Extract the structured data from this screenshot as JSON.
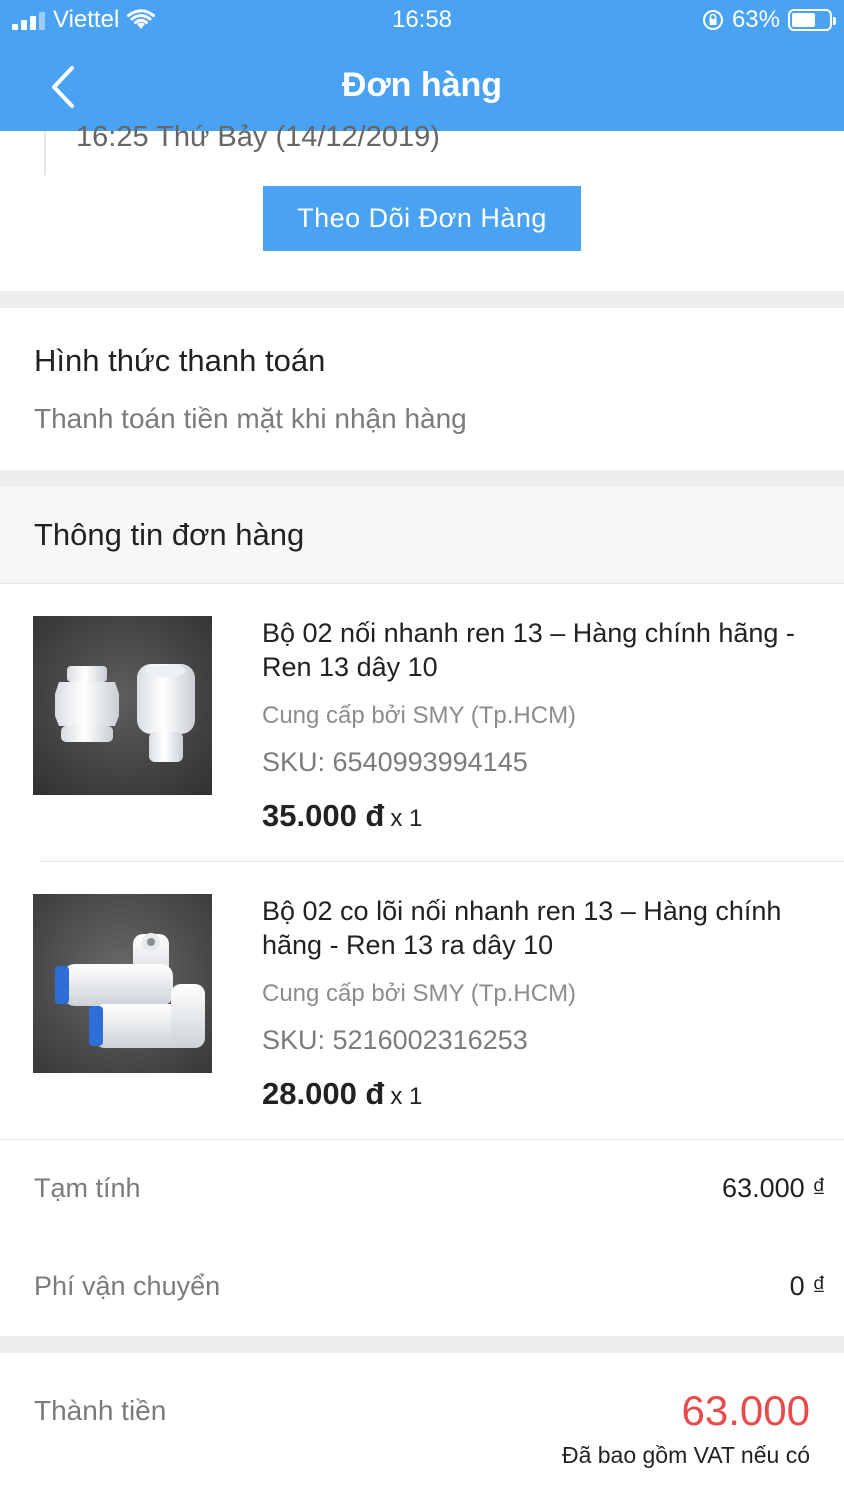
{
  "status_bar": {
    "carrier": "Viettel",
    "time": "16:58",
    "battery": "63%",
    "battery_level": 0.63
  },
  "header": {
    "title": "Đơn hàng"
  },
  "tracking": {
    "time_text": "16:25 Thứ Bảy (14/12/2019)",
    "button_label": "Theo Dõi Đơn Hàng"
  },
  "payment": {
    "heading": "Hình thức thanh toán",
    "method": "Thanh toán tiền mặt khi nhận hàng"
  },
  "order": {
    "heading": "Thông tin đơn hàng",
    "items": [
      {
        "name": "Bộ 02 nối nhanh ren 13 – Hàng chính hãng - Ren 13 dây 10",
        "seller": "Cung cấp bởi SMY (Tp.HCM)",
        "sku": "SKU: 6540993994145",
        "price": "35.000 đ",
        "qty": "x 1"
      },
      {
        "name": "Bộ 02 co lõi nối nhanh ren 13 – Hàng chính hãng - Ren 13 ra dây 10",
        "seller": "Cung cấp bởi SMY (Tp.HCM)",
        "sku": "SKU: 5216002316253",
        "price": "28.000 đ",
        "qty": "x 1"
      }
    ]
  },
  "summary": {
    "subtotal_label": "Tạm tính",
    "subtotal_value": "63.000 ₫",
    "shipping_label": "Phí vận chuyển",
    "shipping_value": "0 ₫",
    "total_label": "Thành tiền",
    "total_value": "63.000",
    "vat_note": "Đã bao gồm VAT nếu có"
  },
  "colors": {
    "header_blue": "#4aa3f2",
    "total_red": "#e74c4c"
  }
}
